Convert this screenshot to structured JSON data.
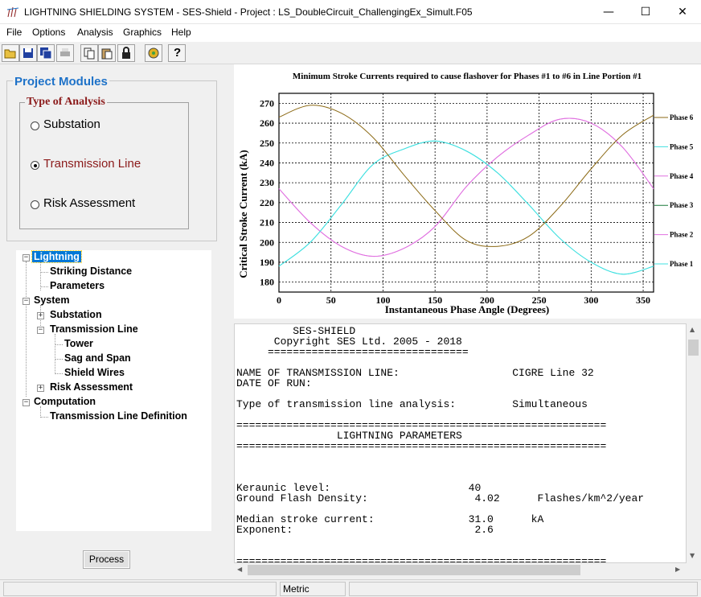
{
  "window": {
    "title": "LIGHTNING SHIELDING SYSTEM - SES-Shield - Project : LS_DoubleCircuit_ChallengingEx_Simult.F05",
    "icons": [
      "minimize-icon",
      "maximize-icon",
      "close-icon"
    ]
  },
  "menu": [
    "File",
    "Options",
    "Analysis",
    "Graphics",
    "Help"
  ],
  "toolbar": {
    "icons": [
      "open-folder-icon",
      "save-icon",
      "save-all-icon",
      "print-icon",
      "copy-icon",
      "paste-icon",
      "lock-icon",
      "settings-icon",
      "help-icon"
    ],
    "help_label": "?"
  },
  "project_modules": {
    "title": "Project Modules",
    "type_of_analysis": {
      "title": "Type of Analysis",
      "options": [
        {
          "label": "Substation",
          "selected": false
        },
        {
          "label": "Transmission Line",
          "selected": true
        },
        {
          "label": "Risk Assessment",
          "selected": false
        }
      ]
    }
  },
  "tree": [
    {
      "label": "Lightning",
      "expander": "−",
      "selected": true
    },
    {
      "label": "Striking Distance"
    },
    {
      "label": "Parameters"
    },
    {
      "label": "System",
      "expander": "−"
    },
    {
      "label": "Substation",
      "expander": "+"
    },
    {
      "label": "Transmission Line",
      "expander": "−"
    },
    {
      "label": "Tower"
    },
    {
      "label": "Sag and Span"
    },
    {
      "label": "Shield Wires"
    },
    {
      "label": "Risk Assessment",
      "expander": "+"
    },
    {
      "label": "Computation",
      "expander": "−"
    },
    {
      "label": "Transmission Line Definition"
    }
  ],
  "process_button": "Process",
  "chart_data": {
    "type": "line",
    "title": "Minimum Stroke Currents required to cause flashover for Phases #1 to #6 in Line Portion #1",
    "xlabel": "Instantaneous Phase Angle (Degrees)",
    "ylabel": "Critical Stroke Current (kA)",
    "xlim": [
      0,
      360
    ],
    "ylim": [
      175,
      275
    ],
    "xticks": [
      0,
      50,
      100,
      150,
      200,
      250,
      300,
      350
    ],
    "yticks": [
      180,
      190,
      200,
      210,
      220,
      230,
      240,
      250,
      260,
      270
    ],
    "grid": true,
    "legend_position": "right",
    "x": [
      0,
      30,
      60,
      90,
      120,
      150,
      180,
      210,
      240,
      270,
      300,
      330,
      360
    ],
    "series": [
      {
        "name": "Phase 1",
        "color": "#40e0e0",
        "values": [
          188,
          200,
          219,
          239,
          247,
          251,
          246,
          235,
          219,
          202,
          190,
          184,
          188
        ]
      },
      {
        "name": "Phase 2",
        "color": "#e070e0",
        "values": [
          227,
          210,
          198,
          193,
          197,
          208,
          228,
          243,
          254,
          262,
          260,
          248,
          227
        ]
      },
      {
        "name": "Phase 3",
        "color": "#1a7a3a",
        "values": []
      },
      {
        "name": "Phase 4",
        "color": "#e070e0",
        "values": [
          227,
          210,
          198,
          193,
          197,
          208,
          228,
          243,
          254,
          262,
          260,
          248,
          227
        ]
      },
      {
        "name": "Phase 5",
        "color": "#40e0e0",
        "values": [
          188,
          200,
          219,
          239,
          247,
          251,
          246,
          235,
          219,
          202,
          190,
          184,
          188
        ]
      },
      {
        "name": "Phase 6",
        "color": "#8b6914",
        "values": [
          263,
          269,
          265,
          253,
          234,
          216,
          201,
          198,
          203,
          218,
          237,
          254,
          264
        ]
      }
    ]
  },
  "report": {
    "lines": [
      "         SES-SHIELD",
      "      Copyright SES Ltd. 2005 - 2018",
      "     ================================",
      "",
      "NAME OF TRANSMISSION LINE:                  CIGRE Line 32",
      "DATE OF RUN:",
      "",
      "Type of transmission line analysis:         Simultaneous",
      "",
      "===========================================================",
      "                LIGHTNING PARAMETERS",
      "===========================================================",
      "",
      "",
      "",
      "Keraunic level:                      40",
      "Ground Flash Density:                 4.02      Flashes/km^2/year",
      "",
      "Median stroke current:               31.0      kA",
      "Exponent:                             2.6",
      "",
      "",
      "==========================================================="
    ]
  },
  "status": {
    "units": "Metric"
  }
}
